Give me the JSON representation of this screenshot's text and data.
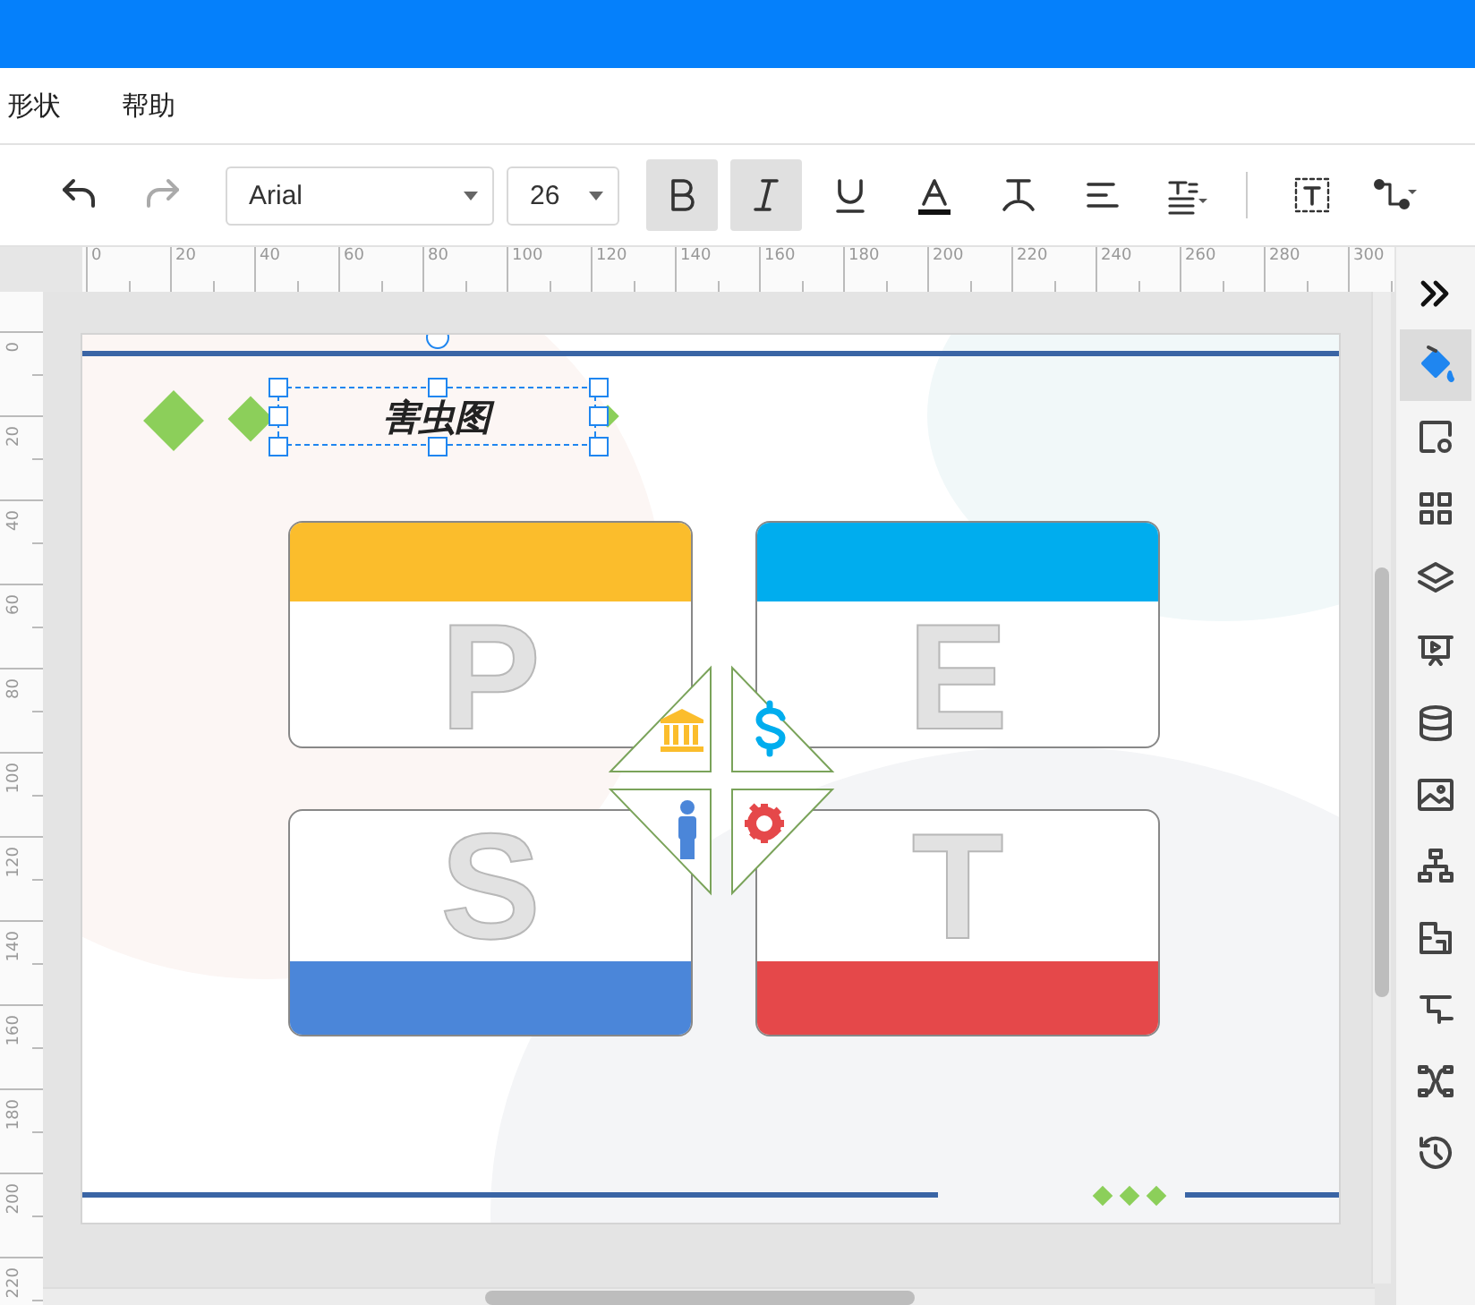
{
  "menu": [
    {
      "label": "形状"
    },
    {
      "label": "帮助"
    }
  ],
  "toolbar": {
    "font": "Arial",
    "size": "26",
    "buttons": [
      {
        "kind": "undo",
        "disabled": false
      },
      {
        "kind": "redo",
        "disabled": true
      }
    ],
    "format": [
      {
        "kind": "bold",
        "on": true
      },
      {
        "kind": "italic",
        "on": true
      },
      {
        "kind": "underline",
        "on": false
      },
      {
        "kind": "color"
      },
      {
        "kind": "curve"
      },
      {
        "kind": "align"
      },
      {
        "kind": "spacing"
      },
      {
        "kind": "separator"
      },
      {
        "kind": "textbox"
      },
      {
        "kind": "connector"
      }
    ]
  },
  "rulers": {
    "horizontal": [
      "0",
      "20",
      "40",
      "60",
      "80",
      "100",
      "120",
      "140",
      "160",
      "180",
      "200",
      "220",
      "240",
      "260",
      "280",
      "300"
    ],
    "vertical": [
      "0",
      "20",
      "40",
      "60",
      "80",
      "100",
      "120",
      "140",
      "160",
      "180",
      "200",
      "220"
    ]
  },
  "diagram": {
    "title": "害虫图",
    "quadrants": [
      {
        "letter": "P",
        "color": "#fbbd2c",
        "kind": "top-band"
      },
      {
        "letter": "E",
        "color": "#00adee",
        "kind": "top-band"
      },
      {
        "letter": "S",
        "color": "#4b86d9",
        "kind": "bottom-band"
      },
      {
        "letter": "T",
        "color": "#e5484a",
        "kind": "bottom-band"
      }
    ]
  },
  "sidebar": [
    {
      "kind": "collapse",
      "selected": false
    },
    {
      "kind": "fill",
      "selected": true
    },
    {
      "kind": "shape-settings",
      "selected": false
    },
    {
      "kind": "widgets",
      "selected": false
    },
    {
      "kind": "layers",
      "selected": false
    },
    {
      "kind": "presentation",
      "selected": false
    },
    {
      "kind": "data",
      "selected": false
    },
    {
      "kind": "image",
      "selected": false
    },
    {
      "kind": "hierarchy",
      "selected": false
    },
    {
      "kind": "floorplan",
      "selected": false
    },
    {
      "kind": "outline",
      "selected": false
    },
    {
      "kind": "mindmap",
      "selected": false
    },
    {
      "kind": "history",
      "selected": false
    }
  ]
}
